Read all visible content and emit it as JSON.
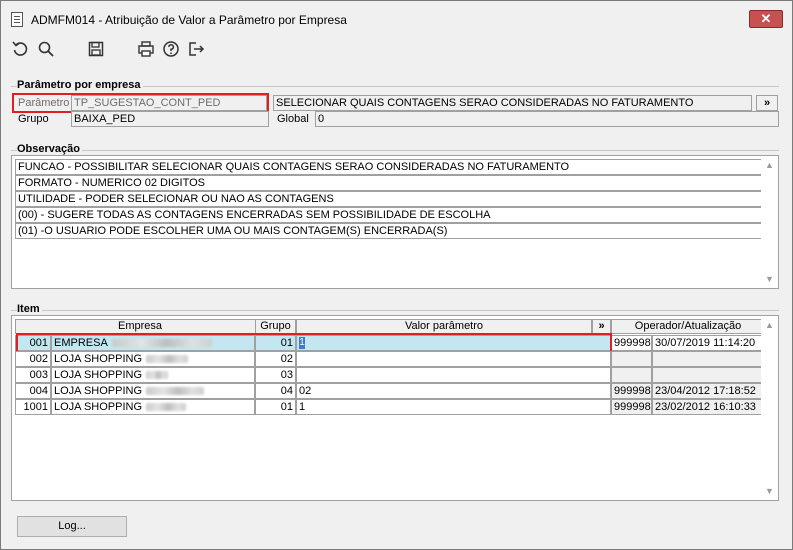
{
  "window": {
    "title": "ADMFM014 - Atribuição de Valor a Parâmetro por Empresa",
    "close_label": "✕"
  },
  "toolbar": {
    "icons": [
      "undo-icon",
      "search-icon",
      "save-icon",
      "print-icon",
      "help-icon",
      "exit-icon"
    ]
  },
  "parametro": {
    "section_title": "Parâmetro por empresa",
    "parametro_label": "Parâmetro",
    "parametro_value": "TP_SUGESTAO_CONT_PED",
    "descricao": "SELECIONAR QUAIS CONTAGENS SERAO CONSIDERADAS NO FATURAMENTO",
    "expand_label": "»",
    "grupo_label": "Grupo",
    "grupo_value": "BAIXA_PED",
    "global_label": "Global",
    "global_value": "0"
  },
  "observacao": {
    "section_title": "Observação",
    "lines": [
      "FUNCAO - POSSIBILITAR SELECIONAR QUAIS CONTAGENS SERAO CONSIDERADAS NO FATURAMENTO",
      "FORMATO - NUMERICO 02 DIGITOS",
      "UTILIDADE - PODER SELECIONAR OU NAO AS CONTAGENS",
      "(00) - SUGERE TODAS AS CONTAGENS ENCERRADAS SEM POSSIBILIDADE DE ESCOLHA",
      "(01) -O USUARIO PODE ESCOLHER UMA OU MAIS CONTAGEM(S) ENCERRADA(S)"
    ]
  },
  "item": {
    "section_title": "Item",
    "headers": {
      "empresa": "Empresa",
      "grupo": "Grupo",
      "valor": "Valor parâmetro",
      "expand": "»",
      "operador": "Operador/Atualização"
    },
    "rows": [
      {
        "codigo": "001",
        "empresa": "EMPRESA",
        "grupo": "01",
        "valor": "1",
        "operador": "999998",
        "data": "30/07/2019 11:14:20"
      },
      {
        "codigo": "002",
        "empresa": "LOJA SHOPPING",
        "grupo": "02",
        "valor": "",
        "operador": "",
        "data": ""
      },
      {
        "codigo": "003",
        "empresa": "LOJA SHOPPING",
        "grupo": "03",
        "valor": "",
        "operador": "",
        "data": ""
      },
      {
        "codigo": "004",
        "empresa": "LOJA SHOPPING",
        "grupo": "04",
        "valor": "02",
        "operador": "999998",
        "data": "23/04/2012 17:18:52"
      },
      {
        "codigo": "1001",
        "empresa": "LOJA SHOPPING",
        "grupo": "01",
        "valor": "1",
        "operador": "999998",
        "data": "23/02/2012 16:10:33"
      }
    ]
  },
  "footer": {
    "log_label": "Log..."
  }
}
